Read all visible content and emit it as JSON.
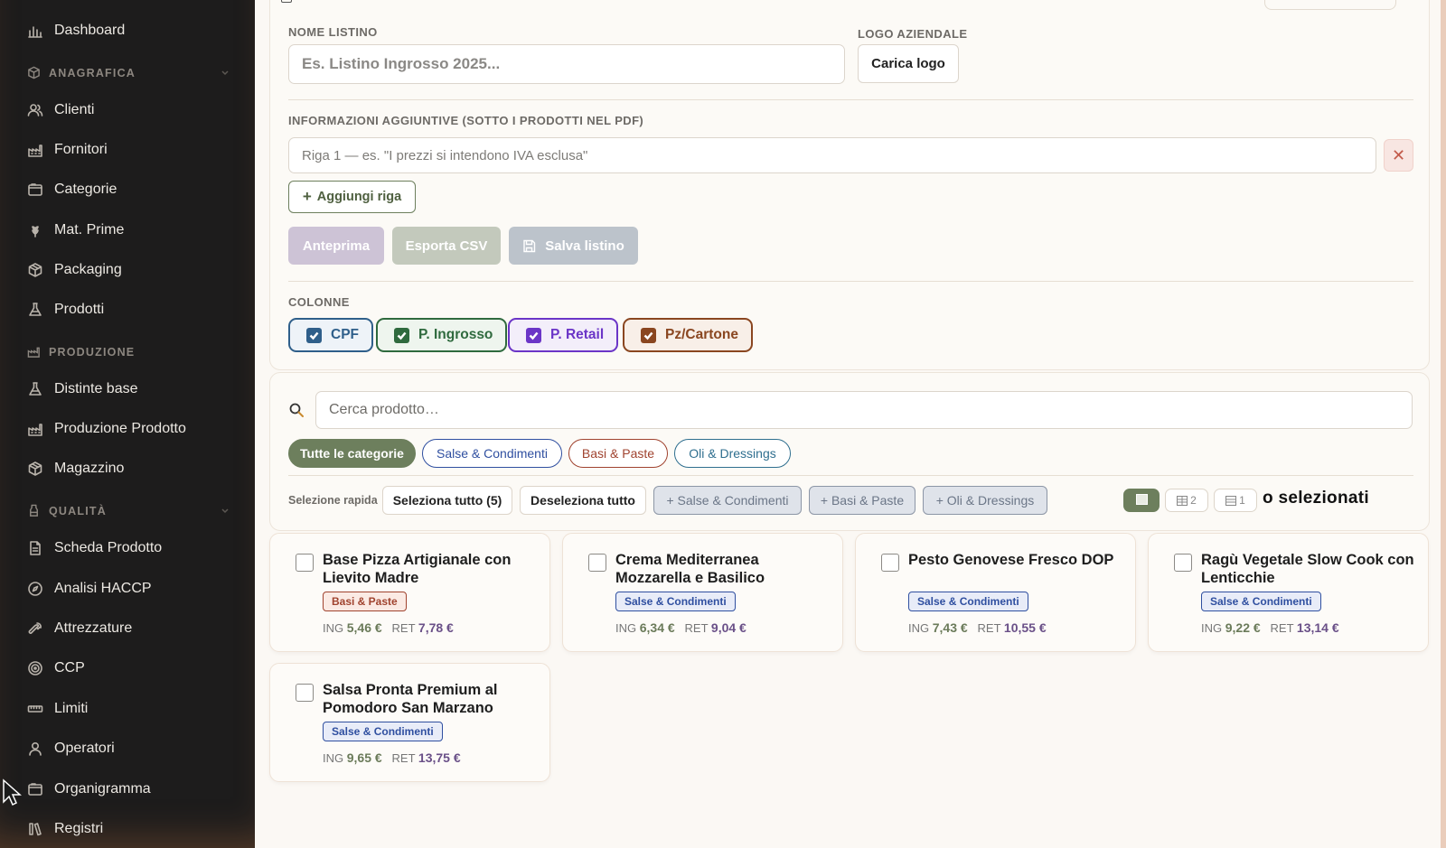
{
  "sidebar": {
    "items": [
      {
        "label": "Dashboard",
        "icon": "bar-chart-icon"
      },
      {
        "label": "Clienti",
        "icon": "users-icon"
      },
      {
        "label": "Fornitori",
        "icon": "factory-icon"
      },
      {
        "label": "Categorie",
        "icon": "folder-icon"
      },
      {
        "label": "Mat. Prime",
        "icon": "wheat-icon"
      },
      {
        "label": "Packaging",
        "icon": "box-icon"
      },
      {
        "label": "Prodotti",
        "icon": "flask-icon"
      },
      {
        "label": "Distinte base",
        "icon": "flask-icon"
      },
      {
        "label": "Produzione Prodotto",
        "icon": "factory-icon"
      },
      {
        "label": "Magazzino",
        "icon": "box-icon"
      },
      {
        "label": "Scheda Prodotto",
        "icon": "file-icon"
      },
      {
        "label": "Analisi HACCP",
        "icon": "compass-icon"
      },
      {
        "label": "Attrezzature",
        "icon": "wrench-icon"
      },
      {
        "label": "CCP",
        "icon": "target-icon"
      },
      {
        "label": "Limiti",
        "icon": "ruler-icon"
      },
      {
        "label": "Operatori",
        "icon": "user-icon"
      },
      {
        "label": "Organigramma",
        "icon": "folder-icon"
      },
      {
        "label": "Registri",
        "icon": "books-icon"
      }
    ],
    "sections": [
      {
        "label": "ANAGRAFICA",
        "icon": "cube-icon"
      },
      {
        "label": "PRODUZIONE",
        "icon": "factory-icon"
      },
      {
        "label": "QUALITÀ",
        "icon": "badge-icon"
      }
    ]
  },
  "form": {
    "nome_label": "NOME LISTINO",
    "nome_placeholder": "Es. Listino Ingrosso 2025...",
    "logo_label": "LOGO AZIENDALE",
    "logo_button": "Carica logo",
    "info_label": "INFORMAZIONI AGGIUNTIVE (SOTTO I PRODOTTI NEL PDF)",
    "info_placeholder": "Riga 1 — es. \"I prezzi si intendono IVA esclusa\"",
    "add_row": "Aggiungi riga",
    "preview": "Anteprima",
    "export_csv": "Esporta CSV",
    "save": "Salva listino",
    "columns_label": "COLONNE",
    "columns": [
      {
        "label": "CPF",
        "color": "#2f5f8a",
        "bg": "#eef3f8"
      },
      {
        "label": "P. Ingrosso",
        "color": "#2f6a3e",
        "bg": "#eef5ee"
      },
      {
        "label": "P. Retail",
        "color": "#6b35c7",
        "bg": "#f3eefa"
      },
      {
        "label": "Pz/Cartone",
        "color": "#8a4620",
        "bg": "#f8efe8"
      }
    ]
  },
  "search": {
    "placeholder": "Cerca prodotto…",
    "categories": [
      {
        "label": "Tutte le categorie"
      },
      {
        "label": "Salse & Condimenti"
      },
      {
        "label": "Basi & Paste"
      },
      {
        "label": "Oli & Dressings"
      }
    ],
    "quick_label": "Selezione rapida",
    "select_all": "Seleziona tutto (5)",
    "deselect_all": "Deseleziona tutto",
    "quick_cats": [
      "+ Salse & Condimenti",
      "+ Basi & Paste",
      "+ Oli & Dressings"
    ],
    "view_2": "2",
    "view_1": "1",
    "selected_text": "o selezionati"
  },
  "products": [
    {
      "name": "Base Pizza Artigianale con Lievito Madre",
      "category": "Basi & Paste",
      "ing": "5,46 €",
      "ret": "7,78 €"
    },
    {
      "name": "Crema Mediterranea Mozzarella e Basilico",
      "category": "Salse & Condimenti",
      "ing": "6,34 €",
      "ret": "9,04 €"
    },
    {
      "name": "Pesto Genovese Fresco DOP",
      "category": "Salse & Condimenti",
      "ing": "7,43 €",
      "ret": "10,55 €"
    },
    {
      "name": "Ragù Vegetale Slow Cook con Lenticchie",
      "category": "Salse & Condimenti",
      "ing": "9,22 €",
      "ret": "13,14 €"
    },
    {
      "name": "Salsa Pronta Premium al Pomodoro San Marzano",
      "category": "Salse & Condimenti",
      "ing": "9,65 €",
      "ret": "13,75 €"
    }
  ],
  "price_labels": {
    "ing": "ING",
    "ret": "RET"
  }
}
